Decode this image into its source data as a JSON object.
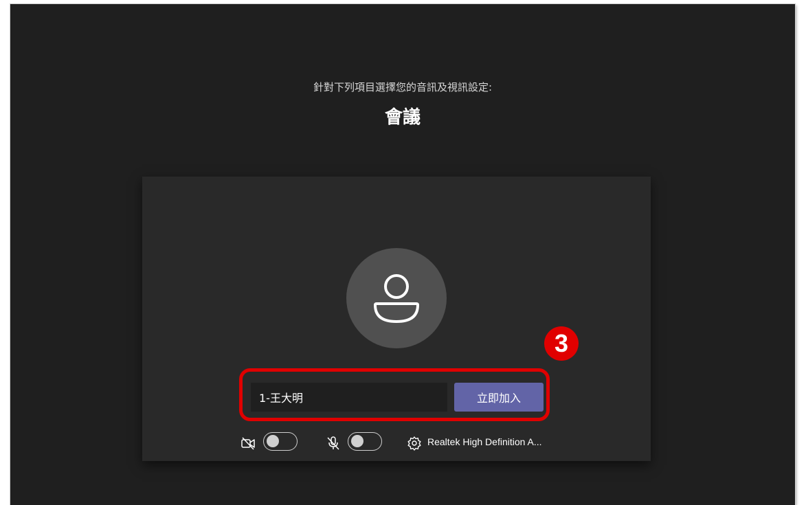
{
  "header": {
    "subtitle": "針對下列項目選擇您的音訊及視訊設定:",
    "title": "會議"
  },
  "annotation": {
    "step_number": "3",
    "color": "#e00000"
  },
  "join_form": {
    "name_value": "1-王大明",
    "join_label": "立即加入"
  },
  "controls": {
    "camera": {
      "icon": "camera-off-icon",
      "on": false
    },
    "microphone": {
      "icon": "mic-off-icon",
      "on": false
    },
    "device": {
      "icon": "gear-icon",
      "label": "Realtek High Definition A..."
    }
  },
  "colors": {
    "background": "#1f1f1f",
    "panel": "#292929",
    "accent": "#6264a7"
  }
}
